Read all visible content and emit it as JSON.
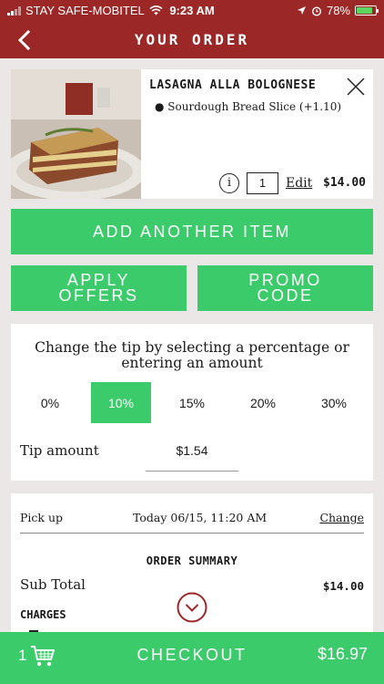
{
  "status": {
    "carrier": "STAY SAFE-MOBITEL",
    "time": "9:23 AM",
    "battery": "78%",
    "battery_level": 0.78
  },
  "header": {
    "title": "YOUR ORDER"
  },
  "item": {
    "name": "LASAGNA ALLA BOLOGNESE",
    "option": "Sourdough Bread Slice (+1.10)",
    "info_glyph": "i",
    "quantity": "1",
    "edit_label": "Edit",
    "price": "$14.00"
  },
  "actions": {
    "add_label": "ADD ANOTHER ITEM",
    "offers_label_1": "APPLY",
    "offers_label_2": "OFFERS",
    "promo_label_1": "PROMO",
    "promo_label_2": "CODE"
  },
  "tip": {
    "description": "Change the tip by selecting a percentage or entering an amount",
    "options": [
      "0%",
      "10%",
      "15%",
      "20%",
      "30%"
    ],
    "selected": "10%",
    "amount_label": "Tip amount",
    "amount_value": "$1.54"
  },
  "summary": {
    "pickup_label": "Pick up",
    "pickup_time": "Today 06/15, 11:20 AM",
    "change_label": "Change",
    "title": "ORDER SUMMARY",
    "subtotal_label": "Sub Total",
    "subtotal_value": "$14.00",
    "charges_label": "CHARGES"
  },
  "checkout": {
    "count": "1",
    "label": "CHECKOUT",
    "total": "$16.97"
  },
  "colors": {
    "brand_red": "#9c2727",
    "accent_green": "#3ccb6b"
  },
  "icons": [
    "signal-icon",
    "wifi-icon",
    "location-icon",
    "alarm-icon",
    "battery-icon",
    "back-chevron-icon",
    "close-icon",
    "info-icon",
    "expand-chevron-icon",
    "cart-icon"
  ]
}
